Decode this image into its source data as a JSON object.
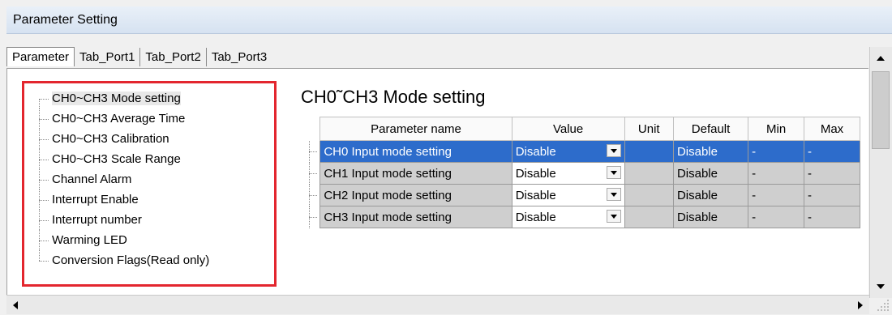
{
  "window": {
    "title": "Parameter Setting"
  },
  "tabs": [
    {
      "label": "Parameter",
      "active": true
    },
    {
      "label": "Tab_Port1"
    },
    {
      "label": "Tab_Port2"
    },
    {
      "label": "Tab_Port3"
    }
  ],
  "tree": {
    "items": [
      "CH0~CH3 Mode setting",
      "CH0~CH3 Average Time",
      "CH0~CH3 Calibration",
      "CH0~CH3 Scale Range",
      "Channel Alarm",
      "Interrupt Enable",
      "Interrupt number",
      "Warming LED",
      "Conversion Flags(Read only)"
    ],
    "selected_index": 0,
    "highlight_color": "#e3262e"
  },
  "section": {
    "title": "CH0˜CH3 Mode setting"
  },
  "table": {
    "headers": [
      "Parameter name",
      "Value",
      "Unit",
      "Default",
      "Min",
      "Max"
    ],
    "rows": [
      {
        "name": "CH0 Input mode setting",
        "value": "Disable",
        "unit": "",
        "default": "Disable",
        "min": "-",
        "max": "-",
        "selected": true
      },
      {
        "name": "CH1 Input mode setting",
        "value": "Disable",
        "unit": "",
        "default": "Disable",
        "min": "-",
        "max": "-"
      },
      {
        "name": "CH2 Input mode setting",
        "value": "Disable",
        "unit": "",
        "default": "Disable",
        "min": "-",
        "max": "-"
      },
      {
        "name": "CH3 Input mode setting",
        "value": "Disable",
        "unit": "",
        "default": "Disable",
        "min": "-",
        "max": "-"
      }
    ],
    "selection_color": "#2d6ccb"
  }
}
